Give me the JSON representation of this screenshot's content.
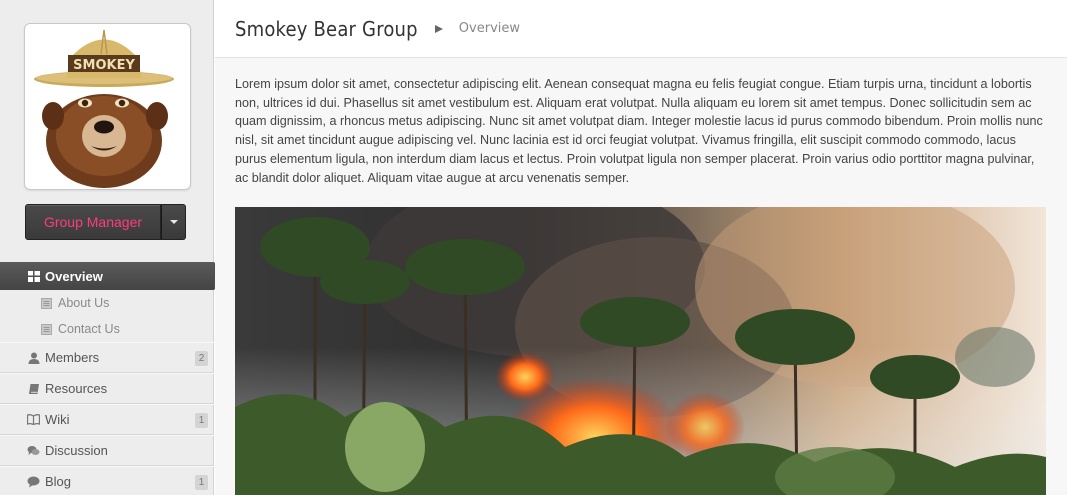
{
  "sidebar": {
    "avatar_hat_text": "SMOKEY",
    "manager_button": "Group Manager",
    "nav": {
      "active": {
        "label": "Overview",
        "icon": "grid-icon"
      },
      "sub_items": [
        {
          "label": "About Us",
          "icon": "page-icon"
        },
        {
          "label": "Contact Us",
          "icon": "page-icon"
        }
      ],
      "items": [
        {
          "label": "Members",
          "icon": "user-icon",
          "badge": "2"
        },
        {
          "label": "Resources",
          "icon": "book-icon",
          "badge": ""
        },
        {
          "label": "Wiki",
          "icon": "open-book-icon",
          "badge": "1"
        },
        {
          "label": "Discussion",
          "icon": "chat-icon",
          "badge": ""
        },
        {
          "label": "Blog",
          "icon": "comment-icon",
          "badge": "1"
        }
      ]
    }
  },
  "header": {
    "title": "Smokey Bear Group",
    "breadcrumb": "Overview"
  },
  "content": {
    "body": "Lorem ipsum dolor sit amet, consectetur adipiscing elit. Aenean consequat magna eu felis feugiat congue. Etiam turpis urna, tincidunt a lobortis non, ultrices id dui. Phasellus sit amet vestibulum est. Aliquam erat volutpat. Nulla aliquam eu lorem sit amet tempus. Donec sollicitudin sem ac quam dignissim, a rhoncus metus adipiscing. Nunc sit amet volutpat diam. Integer molestie lacus id purus commodo bibendum. Proin mollis nunc nisl, sit amet tincidunt augue adipiscing vel. Nunc lacinia est id orci feugiat volutpat. Vivamus fringilla, elit suscipit commodo commodo, lacus purus elementum ligula, non interdum diam lacus et lectus. Proin volutpat ligula non semper placerat. Proin varius odio porttitor magna pulvinar, ac blandit dolor aliquet. Aliquam vitae augue at arcu venenatis semper."
  },
  "colors": {
    "accent": "#ff3b7f",
    "active_nav": "#4e4e4e",
    "sidebar_bg": "#ededed"
  }
}
